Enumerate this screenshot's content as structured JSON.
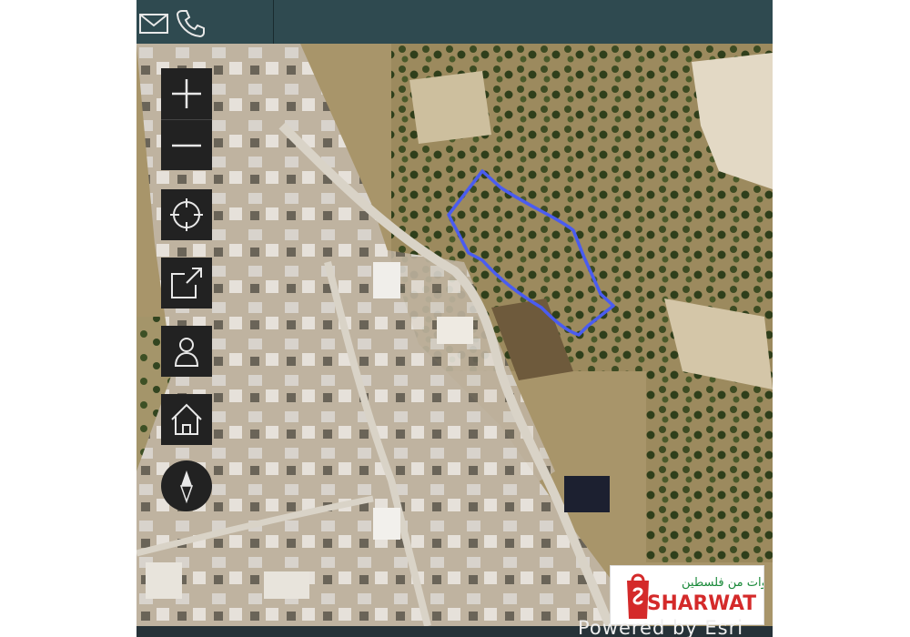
{
  "header": {
    "icons": [
      {
        "name": "mail-icon"
      },
      {
        "name": "phone-icon"
      }
    ]
  },
  "map": {
    "type": "satellite",
    "boundary_color": "#4a5cf0",
    "controls": [
      "zoom-in",
      "zoom-out",
      "locate",
      "share",
      "account",
      "home",
      "compass"
    ]
  },
  "logo": {
    "arabic_text": "شروات من فلسطين",
    "brand": "SHARWAT",
    "brand_color": "#d42a2a",
    "arabic_color": "#1a8a3a"
  },
  "footer": {
    "attribution": "Powered by Esri"
  }
}
